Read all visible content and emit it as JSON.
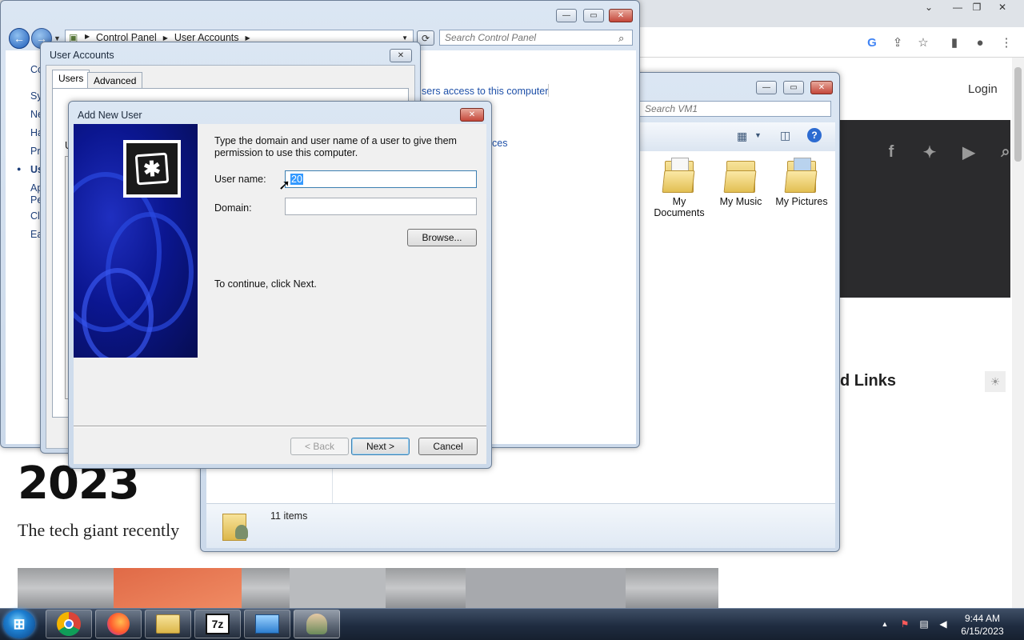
{
  "browser": {
    "login": "Login",
    "links_heading": "d Links",
    "year": "2023",
    "lede": "The tech giant recently"
  },
  "control_panel": {
    "breadcrumb": [
      "Control Panel",
      "User Accounts"
    ],
    "search_placeholder": "Search Control Panel",
    "left_nav": [
      "Co",
      "Sy",
      "Ne",
      "Ha",
      "Pr",
      "Us",
      "Ap",
      "Pe",
      "Cl",
      "Ea"
    ],
    "links": [
      "sers access to this computer",
      "ces"
    ]
  },
  "explorer": {
    "search_placeholder": "Search VM1",
    "folders": [
      {
        "label": "My Documents"
      },
      {
        "label": "My Music"
      },
      {
        "label": "My Pictures"
      }
    ],
    "status": "11 items"
  },
  "user_accounts": {
    "title": "User Accounts",
    "tabs": [
      "Users",
      "Advanced"
    ],
    "fragments": [
      "U"
    ]
  },
  "wizard": {
    "title": "Add New User",
    "instructions": "Type the domain and user name of a user to give them permission to use this computer.",
    "username_label": "User name:",
    "username_value": "20",
    "domain_label": "Domain:",
    "domain_value": "",
    "browse_label": "Browse...",
    "continue_text": "To continue, click Next.",
    "back_label": "< Back",
    "next_label": "Next >",
    "cancel_label": "Cancel"
  },
  "taskbar": {
    "time": "9:44 AM",
    "date": "6/15/2023"
  },
  "colors": {
    "link_blue": "#1e50a8",
    "taskbar": "#1f2c40",
    "selection": "#3399ff"
  }
}
